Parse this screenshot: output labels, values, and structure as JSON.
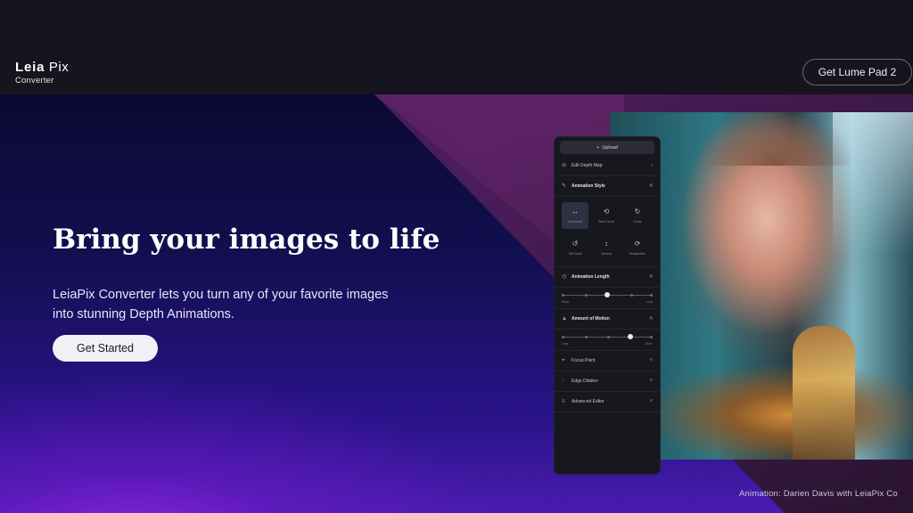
{
  "header": {
    "logo_word": "Leia",
    "logo_word2": "Pix",
    "logo_sub": "Converter",
    "cta_label": "Get Lume Pad 2"
  },
  "hero": {
    "headline": "Bring your images to life",
    "description": "LeiaPix Converter lets you turn any of your favorite images into stunning Depth Animations.",
    "cta_label": "Get Started",
    "credit": "Animation: Darien Davis with LeiaPix Co"
  },
  "panel": {
    "upload_label": "Upload",
    "edit_depth_map": "Edit Depth Map",
    "animation_style": "Animation Style",
    "styles": [
      {
        "label": "Horizontal",
        "icon": "horizontal-arrows-icon",
        "glyph": "↔",
        "selected": true
      },
      {
        "label": "Wide Circle",
        "icon": "wide-circle-icon",
        "glyph": "⟲",
        "selected": false
      },
      {
        "label": "Circle",
        "icon": "circle-icon",
        "glyph": "↻",
        "selected": false
      },
      {
        "label": "Tall Circle",
        "icon": "tall-circle-icon",
        "glyph": "↺",
        "selected": false
      },
      {
        "label": "Vertical",
        "icon": "vertical-arrows-icon",
        "glyph": "↕",
        "selected": false
      },
      {
        "label": "Perspective",
        "icon": "perspective-icon",
        "glyph": "⟳",
        "selected": false
      }
    ],
    "animation_length": "Animation Length",
    "length_min": "Short",
    "length_max": "Long",
    "length_level": 0.5,
    "amount_of_motion": "Amount of Motion",
    "motion_min": "Less",
    "motion_max": "More",
    "motion_level": 0.75,
    "focus_point": "Focus Point",
    "edge_dilation": "Edge Dilation",
    "advanced_editor": "Advanced Editor"
  }
}
